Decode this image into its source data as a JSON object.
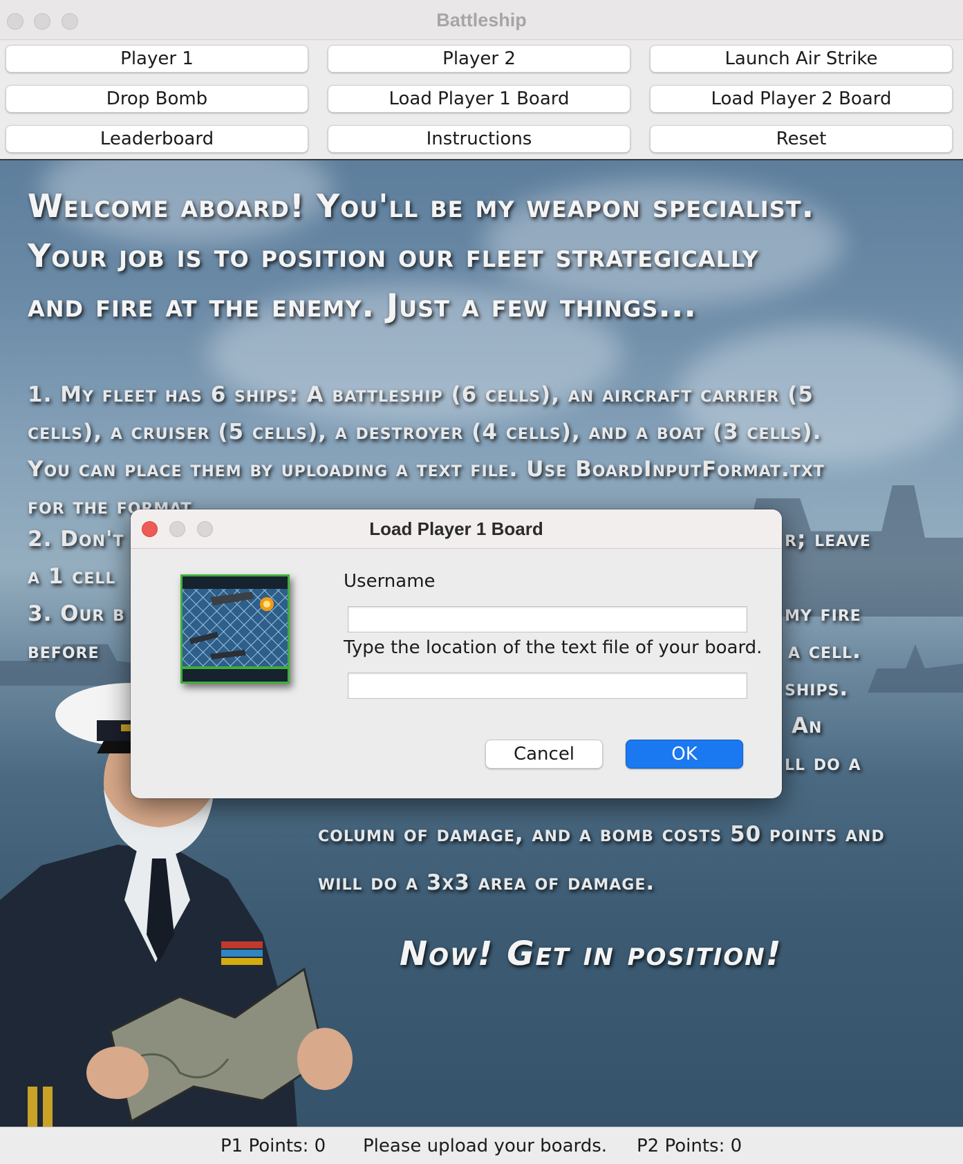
{
  "window": {
    "title": "Battleship"
  },
  "toolbar": {
    "buttons": [
      "Player 1",
      "Player 2",
      "Launch Air Strike",
      "Drop Bomb",
      "Load Player 1 Board",
      "Load Player 2 Board",
      "Leaderboard",
      "Instructions",
      "Reset"
    ]
  },
  "instructions": {
    "intro": "Welcome aboard! You'll be my weapon specialist. Your job is to position our fleet strategically and fire at the enemy. Just a few things...",
    "rule1": "1. My fleet has 6 ships: A battleship (6 cells), an aircraft carrier (5 cells), a cruiser (5 cells), a destroyer (4 cells), and a boat (3 cells). You can place them by uploading a text file. Use BoardInputFormat.txt for the format.",
    "rule2": "2. Don't",
    "rule2_end": "r; leave",
    "rule2_line2": "a 1 cell",
    "rule3": "3. Our b",
    "rule3_end": "my fire",
    "rule3_line2": "before",
    "rule3_line2_end": "a cell.",
    "rule3_line3_end": "ships.",
    "rule3_line4_end": "An",
    "rule3_line5_end": "ll do a",
    "tail": "column of damage, and a bomb costs 50 points and will do a 3x3 area of damage.",
    "cta": "Now! Get in position!"
  },
  "status": {
    "p1_points": "P1 Points: 0",
    "message": "Please upload your boards.",
    "p2_points": "P2 Points: 0"
  },
  "dialog": {
    "title": "Load Player 1 Board",
    "username_label": "Username",
    "username_value": "",
    "file_label": "Type the location of the text file of your board.",
    "file_value": "",
    "cancel_label": "Cancel",
    "ok_label": "OK"
  },
  "colors": {
    "ok_button": "#1a78f0",
    "close_dot": "#ee5b56",
    "thumb_border": "#3fae3a"
  }
}
